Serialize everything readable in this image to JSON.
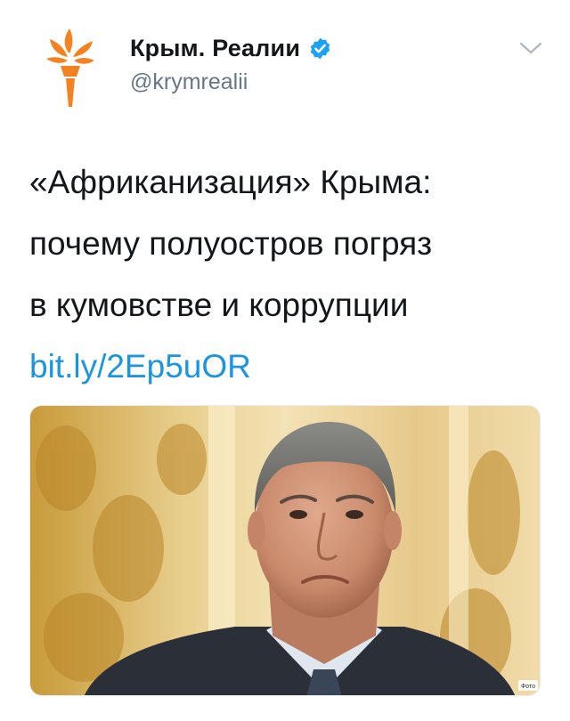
{
  "tweet": {
    "author": {
      "display_name": "Крым. Реалии",
      "handle": "@krymrealii",
      "verified": true,
      "avatar_icon": "torch-logo-icon",
      "brand_color": "#f58220"
    },
    "menu_icon": "chevron-down-icon",
    "text_lines": [
      "«Африканизация» Крыма:",
      "почему полуостров погряз",
      "в кумовстве и коррупции"
    ],
    "link": "bit.ly/2Ep5uOR",
    "link_color": "#1b95e0",
    "media": {
      "type": "photo",
      "watermark": "Фото"
    }
  }
}
